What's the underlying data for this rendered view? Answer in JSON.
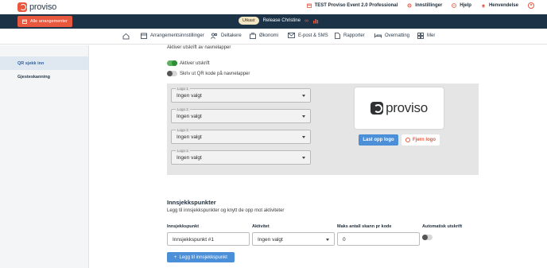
{
  "brand": {
    "name": "proviso",
    "accent": "#e8583e",
    "dark": "#1c3347",
    "blue": "#4a8fd8"
  },
  "topbar": {
    "event": "TEST Proviso Event 2.0 Professional",
    "settings": "Innstillinger",
    "help": "Hjelp",
    "inquiry": "Henvendelse"
  },
  "subbar": {
    "all_events": "Alle arrangementer",
    "status": "Utkast",
    "event_owner": "Release Christine"
  },
  "nav": {
    "items": [
      {
        "label": "",
        "icon": "home-icon"
      },
      {
        "label": "Arrangementsinnstillinger",
        "icon": "calendar-icon"
      },
      {
        "label": "Deltakere",
        "icon": "people-icon"
      },
      {
        "label": "Økonomi",
        "icon": "finance-icon"
      },
      {
        "label": "E-post & SMS",
        "icon": "mail-icon"
      },
      {
        "label": "Rapporter",
        "icon": "report-icon"
      },
      {
        "label": "Overnatting",
        "icon": "bed-icon"
      },
      {
        "label": "Mer",
        "icon": "grid-icon"
      }
    ]
  },
  "sidebar": {
    "items": [
      {
        "label": "QR sjekk inn",
        "active": true
      },
      {
        "label": "Gjesteskanning",
        "active": false
      }
    ]
  },
  "badges": {
    "heading": "Aktiver utskrift av navnelapper",
    "toggle_print": {
      "label": "Aktiver utskrift",
      "on": true
    },
    "toggle_qr": {
      "label": "Skriv ut QR kode på navnelapper",
      "on": false
    },
    "logos": [
      {
        "label": "Logo 1",
        "value": "Ingen valgt"
      },
      {
        "label": "Logo 2",
        "value": "Ingen valgt"
      },
      {
        "label": "Logo 3",
        "value": "Ingen valgt"
      },
      {
        "label": "Logo 4",
        "value": "Ingen valgt"
      }
    ],
    "preview_logo_text": "proviso",
    "upload_label": "Last opp logo",
    "remove_label": "Fjern logo"
  },
  "checkpoints": {
    "title": "Innsjekkspunkter",
    "description": "Legg til innsjekkspunkter og knytt de opp mot aktiviteter",
    "columns": {
      "checkpoint": "Innsjekkspunkt",
      "activity": "Aktivitet",
      "max_scans": "Maks antall skann pr kode",
      "auto_print": "Automatisk utskrift"
    },
    "row": {
      "checkpoint": "Innsjekkspunkt #1",
      "activity": "Ingen valgt",
      "max_scans": "0",
      "auto_print": false
    },
    "add_label": "Legg til innsjekkspunkt"
  }
}
